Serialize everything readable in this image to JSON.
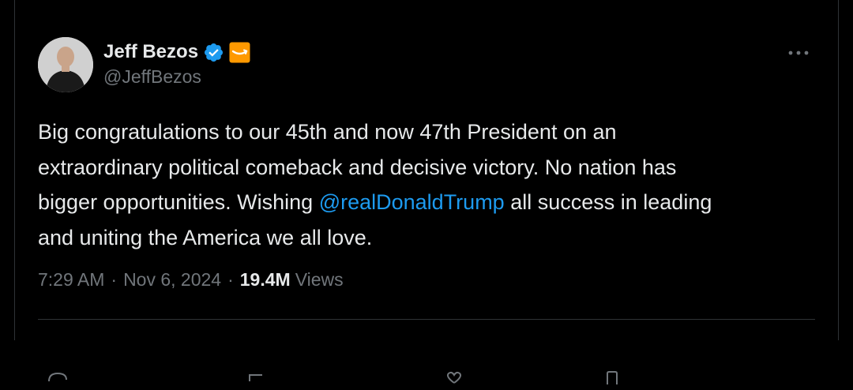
{
  "author": {
    "display_name": "Jeff Bezos",
    "handle": "@JeffBezos",
    "verified_icon": "verified-badge-icon",
    "affiliate_icon": "amazon-affiliate-icon"
  },
  "tweet": {
    "lines": [
      {
        "text": "Big congratulations to our 45th and now 47th President on an"
      },
      {
        "text": "extraordinary political comeback and decisive victory. No nation has"
      },
      {
        "before": "bigger opportunities. Wishing ",
        "mention": "@realDonaldTrump",
        "after": " all success in leading"
      },
      {
        "text": "and uniting the America we all love."
      }
    ]
  },
  "meta": {
    "time": "7:29 AM",
    "date": "Nov 6, 2024",
    "views_count": "19.4M",
    "views_label": "Views",
    "separator": "·"
  },
  "colors": {
    "background": "#000000",
    "text": "#e7e9ea",
    "secondary": "#71767b",
    "link": "#1d9bf0",
    "verified": "#1d9bf0",
    "affiliate": "#ff9900",
    "divider": "#2f3336"
  }
}
